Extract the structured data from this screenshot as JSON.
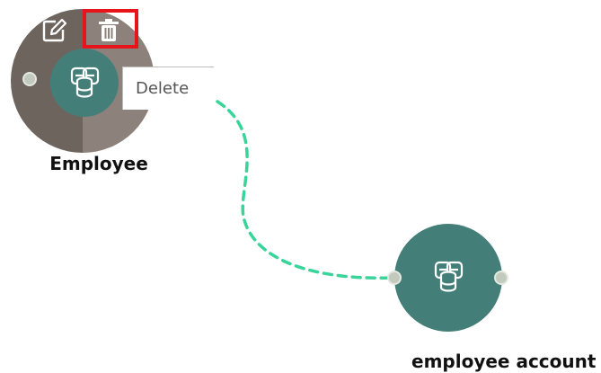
{
  "nodes": [
    {
      "id": "employee",
      "label": "Employee",
      "icon": "database-cluster-icon",
      "color": "#437f78",
      "selected": true,
      "actions": [
        {
          "name": "edit",
          "icon": "edit-icon"
        },
        {
          "name": "delete",
          "icon": "trash-icon"
        }
      ]
    },
    {
      "id": "employee-account",
      "label": "employee account",
      "icon": "database-cluster-icon",
      "color": "#437f78",
      "selected": false
    }
  ],
  "tooltip": {
    "text": "Delete"
  },
  "connection": {
    "from": "employee",
    "to": "employee-account",
    "style": "dashed",
    "color": "#39d49a"
  },
  "colors": {
    "node_fill": "#437f78",
    "selection_ring_dark": "#6e645e",
    "selection_ring_light": "#8d827b",
    "highlight": "#e8141c",
    "port": "#c2c9bd"
  }
}
